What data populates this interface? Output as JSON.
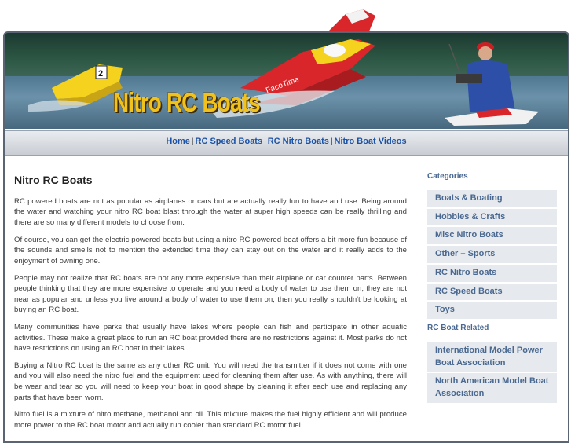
{
  "header": {
    "site_title": "Nitro RC Boats"
  },
  "nav": {
    "items": [
      {
        "label": "Home"
      },
      {
        "label": "RC Speed Boats"
      },
      {
        "label": "RC Nitro Boats"
      },
      {
        "label": "Nitro Boat Videos"
      }
    ],
    "separator": "|"
  },
  "main": {
    "heading": "Nitro RC Boats",
    "paragraphs": [
      "RC powered boats are not as popular as airplanes or cars but are actually really fun to have and use. Being around the water and watching your nitro RC boat blast through the water at super high speeds can be really thrilling and there are so many different models to choose from.",
      "Of course, you can get the electric powered boats but using a nitro RC powered boat offers a bit more fun because of the sounds and smells not to mention the extended time they can stay out on the water and it really adds to the enjoyment of owning one.",
      "People may not realize that RC boats are not any more expensive than their airplane or car counter parts. Between people thinking that they are more expensive to operate and you need a body of water to use them on, they are not near as popular and unless you live around a body of water to use them on, then you really shouldn't be looking at buying an RC boat.",
      "Many communities have parks that usually have lakes where people can fish and participate in other aquatic activities. These make a great place to run an RC boat provided there are no restrictions against it. Most parks do not have restrictions on  using an RC boat in their lakes.",
      "Buying a Nitro RC boat is the same as any other RC unit. You will need the transmitter if it does not come with one and you will also need the nitro fuel and the equipment used for cleaning them after use. As with anything, there will be wear and tear so you will need to keep your boat in good shape by cleaning it after each use and replacing any parts that have been worn.",
      "Nitro fuel is a mixture of nitro methane, methanol and oil. This mixture makes the fuel highly efficient and will produce more power to the RC boat motor and actually run cooler than standard RC motor fuel."
    ]
  },
  "sidebar": {
    "categories_heading": "Categories",
    "categories": [
      {
        "label": "Boats & Boating"
      },
      {
        "label": "Hobbies & Crafts"
      },
      {
        "label": "Misc Nitro Boats"
      },
      {
        "label": "Other – Sports"
      },
      {
        "label": "RC Nitro Boats"
      },
      {
        "label": "RC Speed Boats"
      },
      {
        "label": "Toys"
      }
    ],
    "related_heading": "RC Boat Related",
    "related": [
      {
        "label": "International Model Power Boat Association"
      },
      {
        "label": "North American Model Boat Association"
      }
    ]
  },
  "colors": {
    "title_yellow": "#f2c21c",
    "link_blue": "#1c52a6",
    "sidebar_text": "#4a6890",
    "sidebar_bg": "#e6eaee"
  }
}
